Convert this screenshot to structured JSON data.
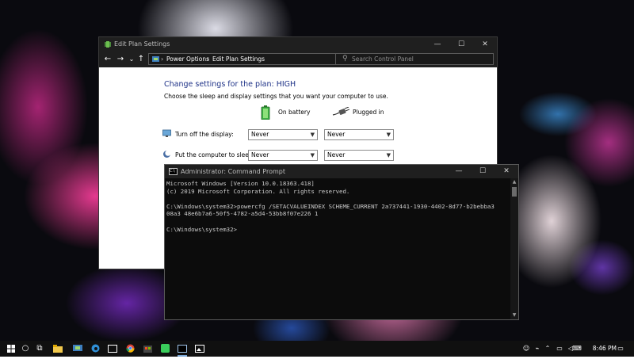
{
  "control_panel": {
    "title": "Edit Plan Settings",
    "breadcrumbs": [
      "Power Options",
      "Edit Plan Settings"
    ],
    "search": {
      "placeholder": "Search Control Panel"
    },
    "heading": "Change settings for the plan: HIGH",
    "subheading": "Choose the sleep and display settings that you want your computer to use.",
    "columns": {
      "battery": "On battery",
      "plugged": "Plugged in"
    },
    "rows": [
      {
        "label": "Turn off the display:",
        "battery": "Never",
        "plugged": "Never"
      },
      {
        "label": "Put the computer to sleep:",
        "battery": "Never",
        "plugged": "Never"
      }
    ],
    "window_controls": {
      "minimize": "—",
      "maximize": "☐",
      "close": "✕"
    }
  },
  "cmd": {
    "title": "Administrator: Command Prompt",
    "lines": [
      "Microsoft Windows [Version 10.0.18363.418]",
      "(c) 2019 Microsoft Corporation. All rights reserved.",
      "",
      "C:\\Windows\\system32>powercfg /SETACVALUEINDEX SCHEME_CURRENT 2a737441-1930-4402-8d77-b2bebba3",
      "08a3 48e6b7a6-50f5-4782-a5d4-53bb8f07e226 1",
      "",
      "C:\\Windows\\system32>"
    ],
    "window_controls": {
      "minimize": "—",
      "maximize": "☐",
      "close": "✕"
    }
  },
  "taskbar": {
    "clock": "8:46 PM",
    "icons": [
      "windows-start",
      "cortana-search",
      "task-view",
      "file-explorer",
      "control-panel",
      "edge",
      "chrome",
      "store",
      "line-app",
      "command-prompt",
      "photos"
    ],
    "tray_icons": [
      "people",
      "network",
      "volume",
      "chevron-up",
      "keyboard",
      "notification"
    ]
  },
  "colors": {
    "heading": "#1e3287",
    "titlebar": "#1f1f1f",
    "cmd_bg": "#0c0c0c",
    "cmd_text": "#cccccc",
    "taskbar": "#101010"
  }
}
